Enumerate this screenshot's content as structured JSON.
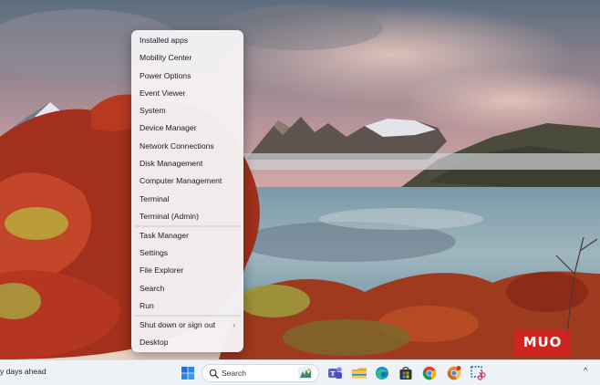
{
  "menu": {
    "items": [
      {
        "label": "Installed apps",
        "name": "menu-item-installed-apps"
      },
      {
        "label": "Mobility Center",
        "name": "menu-item-mobility-center"
      },
      {
        "label": "Power Options",
        "name": "menu-item-power-options"
      },
      {
        "label": "Event Viewer",
        "name": "menu-item-event-viewer"
      },
      {
        "label": "System",
        "name": "menu-item-system"
      },
      {
        "label": "Device Manager",
        "name": "menu-item-device-manager"
      },
      {
        "label": "Network Connections",
        "name": "menu-item-network-connections"
      },
      {
        "label": "Disk Management",
        "name": "menu-item-disk-management"
      },
      {
        "label": "Computer Management",
        "name": "menu-item-computer-management"
      },
      {
        "label": "Terminal",
        "name": "menu-item-terminal"
      },
      {
        "label": "Terminal (Admin)",
        "name": "menu-item-terminal-admin"
      },
      {
        "separator": true
      },
      {
        "label": "Task Manager",
        "name": "menu-item-task-manager"
      },
      {
        "label": "Settings",
        "name": "menu-item-settings"
      },
      {
        "label": "File Explorer",
        "name": "menu-item-file-explorer"
      },
      {
        "label": "Search",
        "name": "menu-item-search"
      },
      {
        "label": "Run",
        "name": "menu-item-run"
      },
      {
        "separator": true
      },
      {
        "label": "Shut down or sign out",
        "name": "menu-item-shut-down",
        "submenu": true,
        "chevron": "›"
      },
      {
        "label": "Desktop",
        "name": "menu-item-desktop"
      }
    ]
  },
  "taskbar": {
    "weather_text": "y days ahead",
    "search_label": "Search",
    "tray_chevron": "^",
    "icons": [
      {
        "name": "start-icon"
      },
      {
        "name": "teams-meet-icon"
      },
      {
        "name": "file-explorer-icon"
      },
      {
        "name": "edge-icon"
      },
      {
        "name": "microsoft-store-icon"
      },
      {
        "name": "chrome-icon"
      },
      {
        "name": "chrome-canary-icon"
      },
      {
        "name": "snipping-tool-icon"
      }
    ]
  },
  "watermark": {
    "text": "MUO"
  },
  "colors": {
    "menu_bg": "#f5f2f4",
    "taskbar_bg": "#eef1f6",
    "watermark_red": "#d52323",
    "start_blue": "#1f6fd6"
  }
}
